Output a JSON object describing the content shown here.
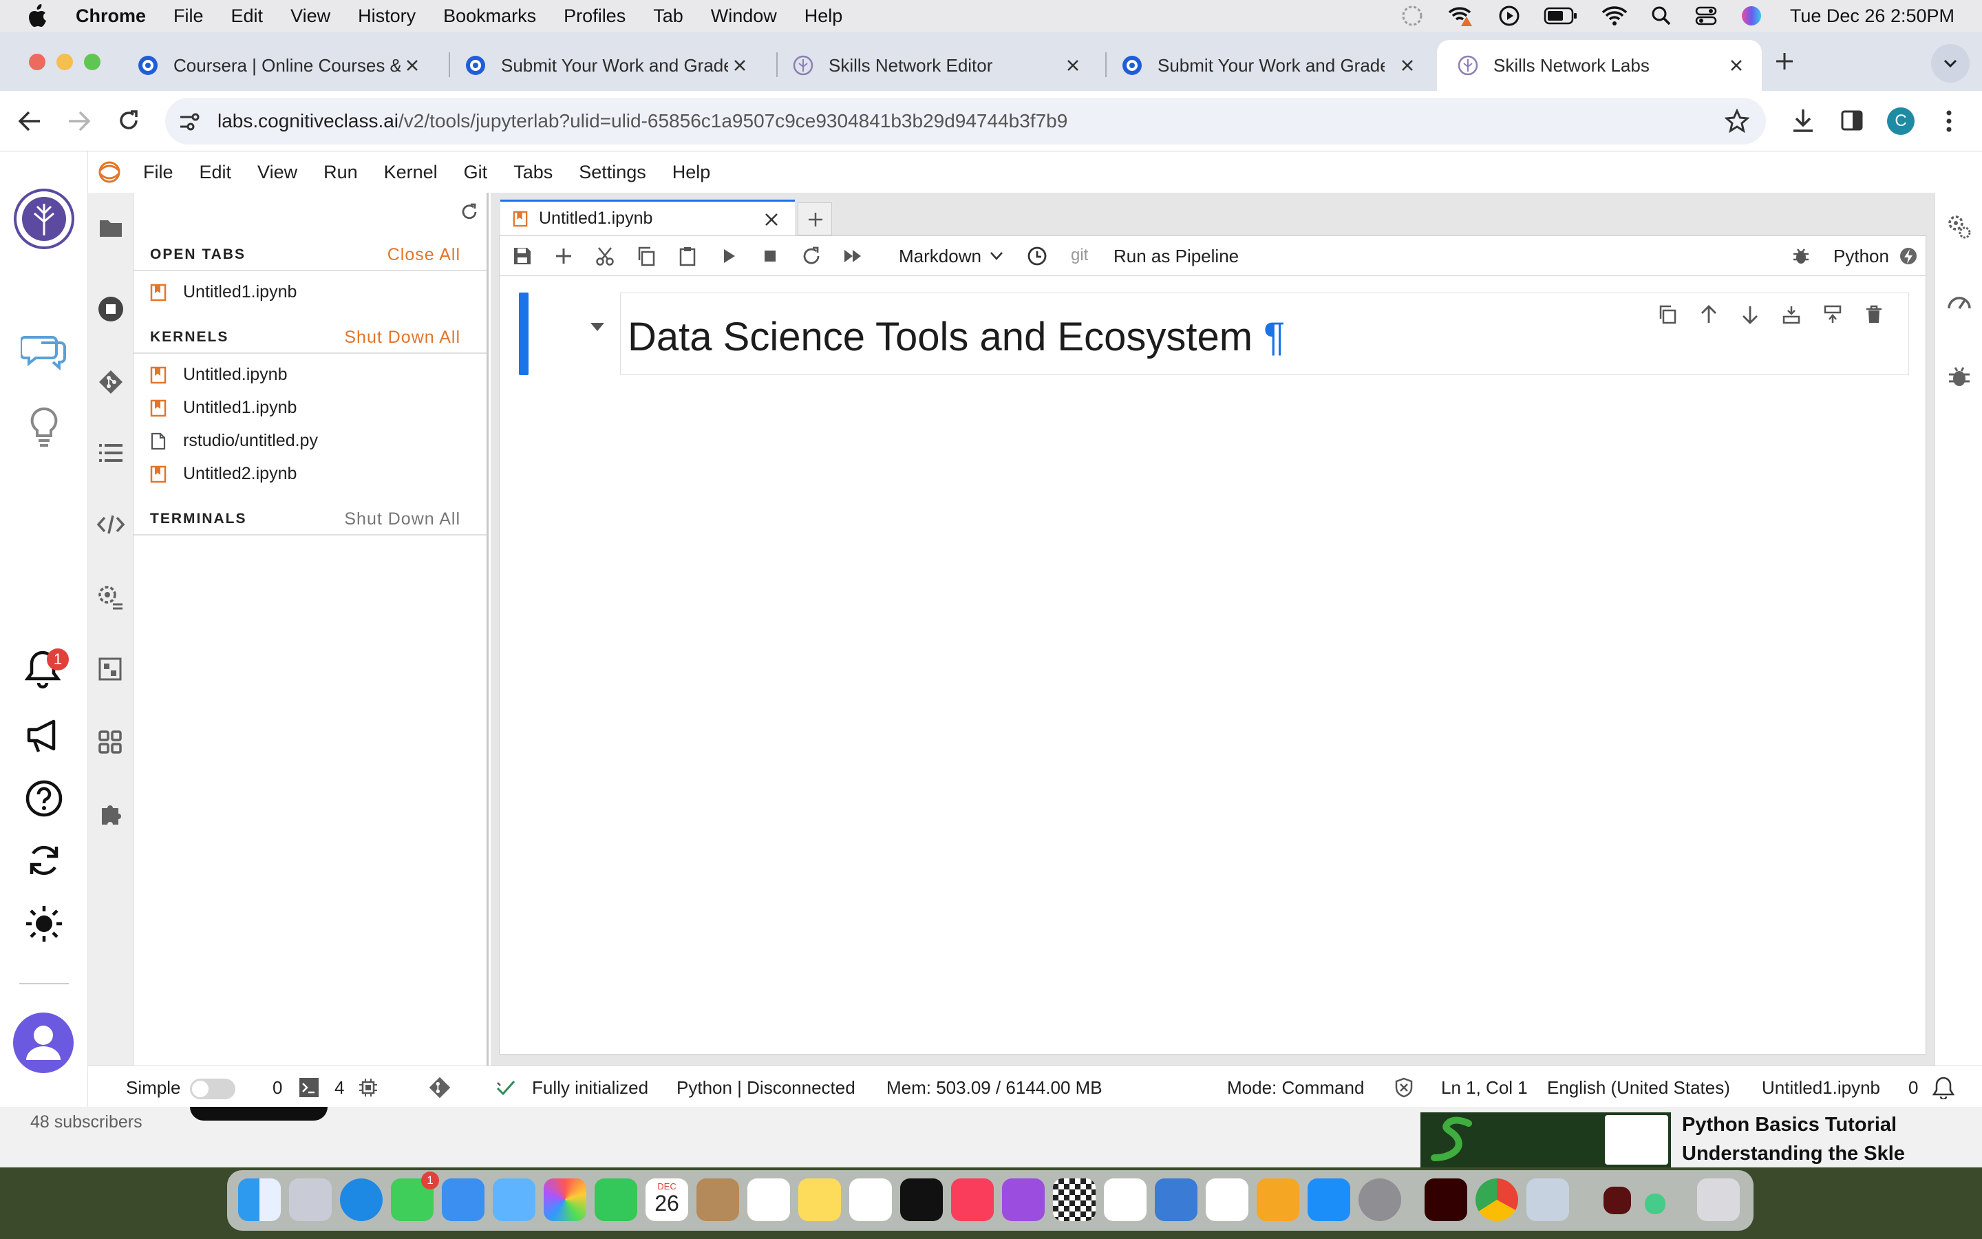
{
  "menubar": {
    "app": "Chrome",
    "items": [
      "File",
      "Edit",
      "View",
      "History",
      "Bookmarks",
      "Profiles",
      "Tab",
      "Window",
      "Help"
    ],
    "clock": "Tue Dec 26  2:50PM",
    "status_icons": [
      "moon-icon",
      "wifi-warning-icon",
      "play-icon",
      "battery-icon",
      "wifi-icon",
      "spotlight-icon",
      "control-center-icon",
      "siri-icon"
    ]
  },
  "browser": {
    "tabs": [
      {
        "title": "Coursera | Online Courses & C"
      },
      {
        "title": "Submit Your Work and Grade"
      },
      {
        "title": "Skills Network Editor"
      },
      {
        "title": "Submit Your Work and Grade"
      },
      {
        "title": "Skills Network Labs"
      }
    ],
    "url_host": "labs.cognitiveclass.ai",
    "url_path": "/v2/tools/jupyterlab?ulid=ulid-65856c1a9507c9ce9304841b3b29d94744b3f7b9",
    "avatar_letter": "C"
  },
  "jupyter": {
    "menu": [
      "File",
      "Edit",
      "View",
      "Run",
      "Kernel",
      "Git",
      "Tabs",
      "Settings",
      "Help"
    ],
    "notification_count": "1",
    "panel": {
      "open_tabs": {
        "title": "OPEN TABS",
        "action": "Close All",
        "items": [
          "Untitled1.ipynb"
        ]
      },
      "kernels": {
        "title": "KERNELS",
        "action": "Shut Down All",
        "items": [
          "Untitled.ipynb",
          "Untitled1.ipynb",
          "rstudio/untitled.py",
          "Untitled2.ipynb"
        ]
      },
      "terminals": {
        "title": "TERMINALS",
        "action": "Shut Down All"
      }
    },
    "doc_tab": "Untitled1.ipynb",
    "toolbar": {
      "cell_type": "Markdown",
      "git": "git",
      "pipeline": "Run as Pipeline",
      "kernel": "Python"
    },
    "cell": {
      "heading": "Data Science Tools and Ecosystem",
      "pilcrow": "¶"
    },
    "status": {
      "mode_label": "Simple",
      "term_count": "0",
      "kernel_count": "4",
      "init": "Fully initialized",
      "kernel_state": "Python | Disconnected",
      "mem": "Mem: 503.09 / 6144.00 MB",
      "mode": "Mode: Command",
      "cursor": "Ln 1, Col 1",
      "language": "English (United States)",
      "file": "Untitled1.ipynb",
      "count": "0"
    }
  },
  "background": {
    "subscribers": "48 subscribers",
    "video_title_1": "Python Basics Tutorial",
    "video_title_2": "Understanding the Skle"
  },
  "dock": {
    "calendar_month": "DEC",
    "calendar_day": "26",
    "messages_badge": "1"
  },
  "colors": {
    "accent_orange": "#e3762a",
    "jupyter_blue": "#1a73e8",
    "sn_purple": "#5b4aa0"
  }
}
